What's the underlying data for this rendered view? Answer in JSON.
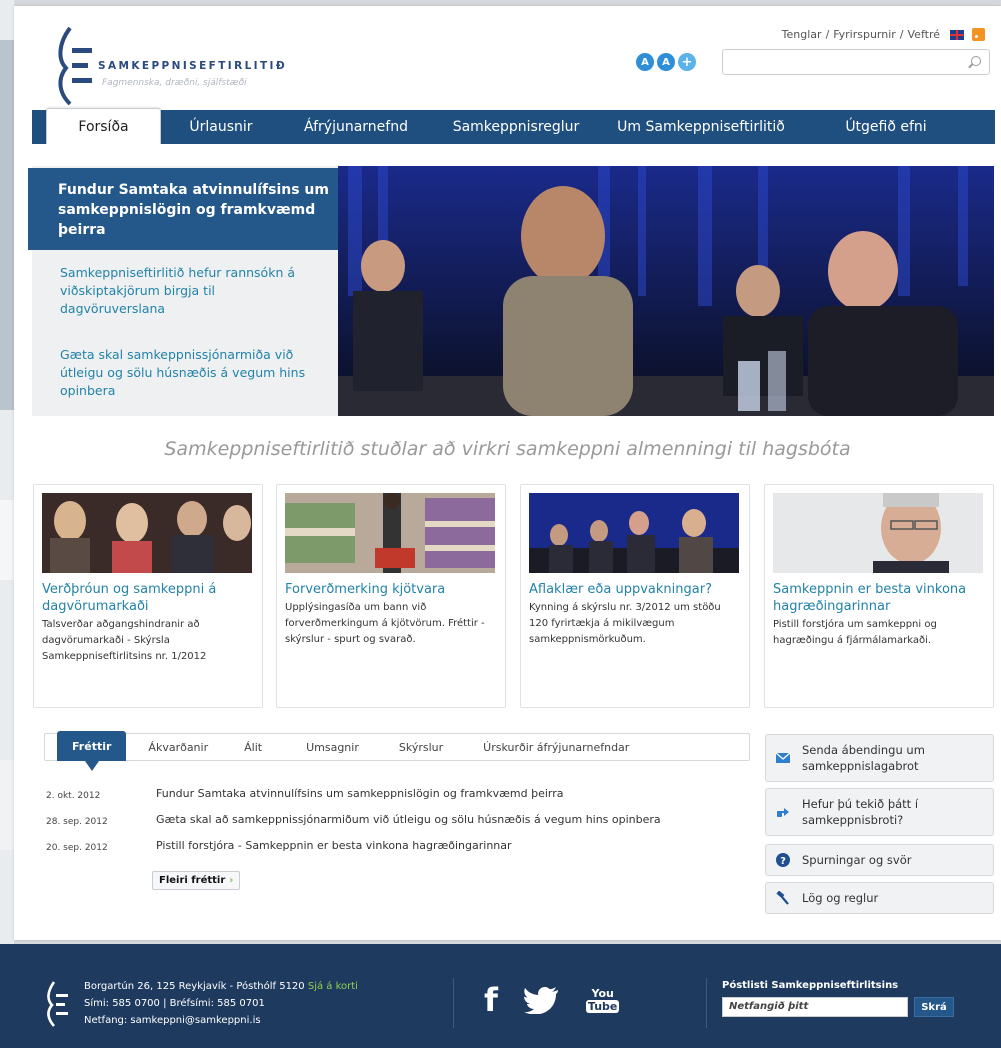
{
  "header": {
    "logo_title": "SAMKEPPNISEFTIRLITIÐ",
    "logo_tagline": "Fagmennska, dræðni, sjálfstæði",
    "top_links": [
      "Tenglar",
      "Fyrirspurnir",
      "Veftré"
    ],
    "separator": "/",
    "a11y_small": "A",
    "a11y_large": "A",
    "a11y_plus": "+",
    "search_placeholder": ""
  },
  "nav": {
    "items": [
      "Forsíða",
      "Úrlausnir",
      "Áfrýjunarnefnd",
      "Samkeppnisreglur",
      "Um Samkeppniseftirlitið",
      "Útgefið efni"
    ],
    "active": "Forsíða"
  },
  "hero": {
    "active_item": "Fundur Samtaka atvinnulífsins um samkeppnislögin og framkvæmd þeirra",
    "items": [
      "Samkeppniseftirlitið hefur rannsókn á viðskiptakjörum birgja til dagvöruverslana",
      "Gæta skal samkeppnissjónarmiða við útleigu og sölu húsnæðis á vegum hins opinbera"
    ]
  },
  "slogan": "Samkeppniseftirlitið stuðlar að virkri samkeppni almenningi til hagsbóta",
  "cards": [
    {
      "title": "Verðþróun og samkeppni á dagvörumarkaði",
      "desc": "Talsverðar aðgangshindranir að dagvörumarkaði - Skýrsla Samkeppniseftirlitsins nr. 1/2012"
    },
    {
      "title": "Forverðmerking kjötvara",
      "desc": "Upplýsingasíða um bann við forverðmerkingum á kjötvörum. Fréttir - skýrslur - spurt og svarað."
    },
    {
      "title": "Aflaklær eða uppvakningar?",
      "desc": "Kynning á skýrslu nr. 3/2012 um stöðu 120 fyrirtækja á mikilvægum samkeppnismörkuðum."
    },
    {
      "title": "Samkeppnin er besta vinkona hagræðingarinnar",
      "desc": "Pistill forstjóra um samkeppni og hagræðingu á fjármálamarkaði."
    }
  ],
  "tabs": {
    "items": [
      "Fréttir",
      "Ákvarðanir",
      "Álit",
      "Umsagnir",
      "Skýrslur",
      "Úrskurðir áfrýjunarnefndar"
    ],
    "active": "Fréttir"
  },
  "news": [
    {
      "date": "2. okt. 2012",
      "title": "Fundur Samtaka atvinnulífsins um samkeppnislögin og framkvæmd þeirra"
    },
    {
      "date": "28. sep. 2012",
      "title": "Gæta skal að samkeppnissjónarmiðum við útleigu og sölu húsnæðis á vegum hins opinbera"
    },
    {
      "date": "20. sep. 2012",
      "title": "Pistill forstjóra - Samkeppnin er besta vinkona hagræðingarinnar"
    }
  ],
  "more_news": "Fleiri fréttir",
  "more_arrow": "›",
  "side_buttons": [
    {
      "label": "Senda ábendingu um samkeppnislagabrot",
      "icon": "envelope-icon"
    },
    {
      "label": "Hefur þú tekið þátt í samkeppnisbroti?",
      "icon": "hand-pointing-icon"
    },
    {
      "label": "Spurningar og svör",
      "icon": "question-icon"
    },
    {
      "label": "Lög og reglur",
      "icon": "gavel-icon"
    }
  ],
  "footer": {
    "address": "Borgartún 26, 125 Reykjavík - Pósthólf 5120",
    "map_link": "Sjá á korti",
    "phone": "Sími: 585 0700 | Bréfsími: 585 0701",
    "email": "Netfang: samkeppni@samkeppni.is",
    "facebook": "f",
    "youtube_top": "You",
    "youtube_bottom": "Tube",
    "newsletter_label": "Póstlisti Samkeppniseftirlitsins",
    "newsletter_placeholder": "Netfangið þitt",
    "newsletter_button": "Skrá"
  },
  "colors": {
    "nav_blue": "#1f4f7e",
    "accent_blue": "#24578a",
    "link_teal": "#2283a8",
    "footer_bg": "#1f3a5f",
    "map_green": "#8fd14f"
  }
}
